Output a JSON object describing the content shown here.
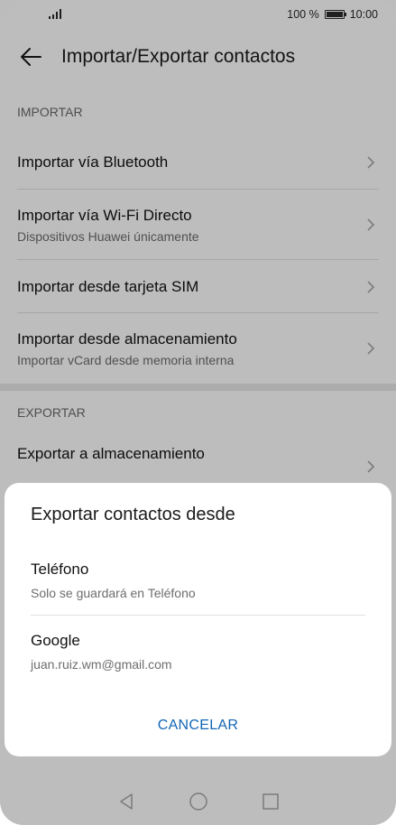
{
  "status_bar": {
    "battery_text": "100 %",
    "time": "10:00",
    "icons": [
      "signal-icon",
      "battery-icon"
    ]
  },
  "header": {
    "back_icon": "arrow-left-icon",
    "title": "Importar/Exportar contactos"
  },
  "import_section": {
    "label": "IMPORTAR",
    "items": [
      {
        "primary": "Importar vía Bluetooth",
        "secondary": ""
      },
      {
        "primary": "Importar vía Wi-Fi Directo",
        "secondary": "Dispositivos Huawei únicamente"
      },
      {
        "primary": "Importar desde tarjeta SIM",
        "secondary": ""
      },
      {
        "primary": "Importar desde almacenamiento",
        "secondary": "Importar vCard desde memoria interna"
      }
    ]
  },
  "export_section": {
    "label": "EXPORTAR",
    "items": [
      {
        "primary": "Exportar a almacenamiento"
      }
    ]
  },
  "dialog": {
    "title": "Exportar contactos desde",
    "options": [
      {
        "primary": "Teléfono",
        "secondary": "Solo se guardará en Teléfono"
      },
      {
        "primary": "Google",
        "secondary": "juan.ruiz.wm@gmail.com"
      }
    ],
    "cancel_label": "CANCELAR",
    "accent_color": "#1265b3"
  },
  "nav_bar": {
    "icons": [
      "back-triangle-icon",
      "home-circle-icon",
      "recents-square-icon"
    ]
  }
}
